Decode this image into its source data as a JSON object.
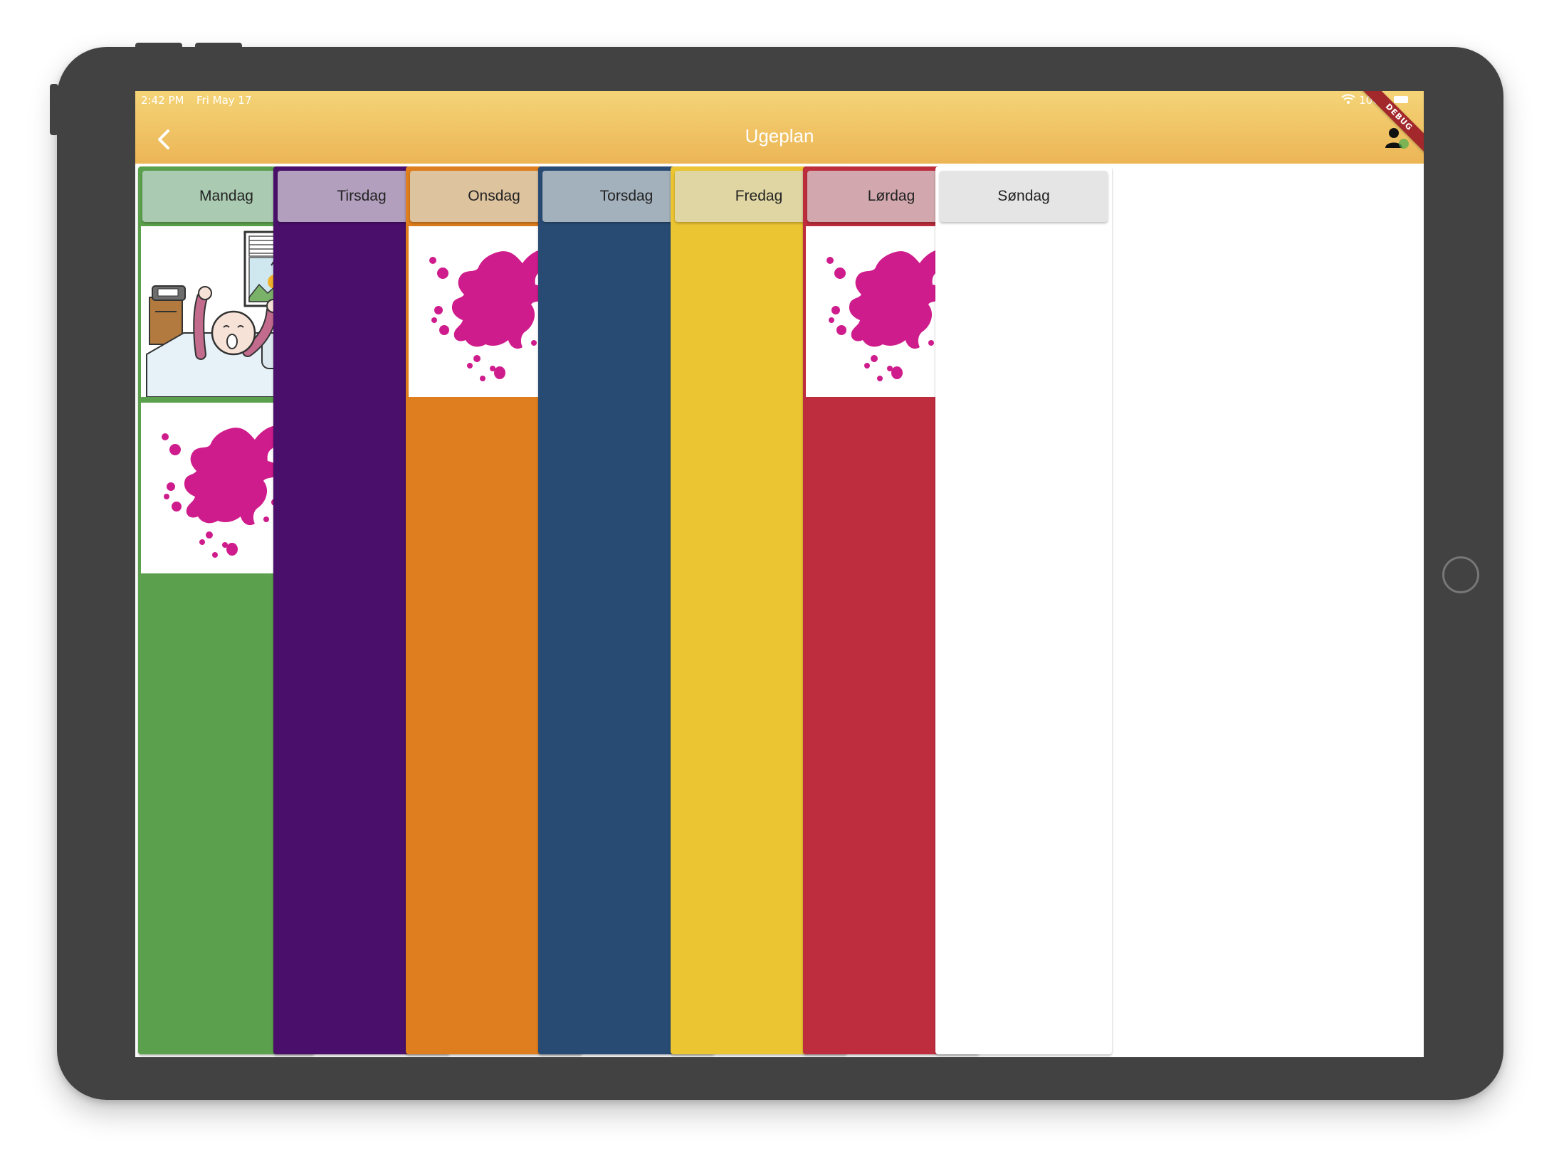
{
  "status_bar": {
    "time": "2:42 PM",
    "date": "Fri May 17",
    "battery": "100%"
  },
  "debug_banner": "DEBUG",
  "app_bar": {
    "title": "Ugeplan",
    "back_icon": "chevron-left-icon",
    "profile_icon": "person-icon"
  },
  "days": [
    {
      "name": "Mandag",
      "color": "#5ba14d",
      "header_color": "#aacbb1",
      "cards": [
        "wake-up-pictogram",
        "paint-splat-pictogram"
      ]
    },
    {
      "name": "Tirsdag",
      "color": "#4a0f6a",
      "header_color": "#b19fbd",
      "cards": []
    },
    {
      "name": "Onsdag",
      "color": "#de7e1e",
      "header_color": "#dec39f",
      "cards": [
        "paint-splat-pictogram"
      ]
    },
    {
      "name": "Torsdag",
      "color": "#284b74",
      "header_color": "#a3b1bd",
      "cards": []
    },
    {
      "name": "Fredag",
      "color": "#ecc532",
      "header_color": "#e0d6a3",
      "cards": []
    },
    {
      "name": "Lørdag",
      "color": "#be2d3d",
      "header_color": "#d2a8ae",
      "cards": [
        "paint-splat-pictogram"
      ]
    },
    {
      "name": "Søndag",
      "color": "#ffffff",
      "header_color": "#e5e5e5",
      "cards": []
    }
  ],
  "colors": {
    "app_bar_top": "#f4d477",
    "app_bar_bottom": "#ecb556",
    "device_frame": "#424242",
    "splat": "#cf1c8c"
  }
}
